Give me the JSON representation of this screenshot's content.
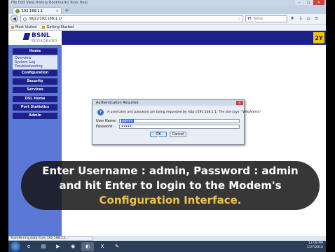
{
  "browser": {
    "menu_text": "File  Edit  View  History  Bookmarks  Tools  Help",
    "tab_title": "192.168.1.1",
    "new_tab": "+",
    "url": "http://192.168.1.1/",
    "search_placeholder": "Yahoo",
    "search_engine": "Y!",
    "bookmarks": [
      "Most Visited",
      "Getting Started"
    ],
    "status": "Transferring data from 192.168.1.1..."
  },
  "page": {
    "brand": "BSNL",
    "brand_sub": "BROADBAND",
    "corner_logo": "2Y",
    "nav": {
      "home": "Home",
      "sub_items": [
        "Overview",
        "System Log",
        "Troubleshooting"
      ],
      "items": [
        "Configuration",
        "Security",
        "Services",
        "DSL Home",
        "Port Statistics",
        "Admin"
      ]
    }
  },
  "dialog": {
    "title": "Authentication Required",
    "message": "A username and password are being requested by http://192.168.1.1. The site says: \"WebAdmin\"",
    "username_label": "User Name:",
    "username_value": "admin",
    "password_label": "Password:",
    "password_value": "•••••",
    "ok_label": "OK",
    "cancel_label": "Cancel",
    "close": "x"
  },
  "caption": {
    "line1": "Enter Username : admin, Password : admin",
    "line2": "and hit Enter to login to the Modem's",
    "line3": "Configuration Interface."
  },
  "taskbar": {
    "time": "12:08 PM",
    "date": "11/7/2014"
  },
  "colors": {
    "header_blue": "#1d1f8a",
    "sidebar_blue": "#5c78d6",
    "caption_yellow": "#f0c04a"
  }
}
